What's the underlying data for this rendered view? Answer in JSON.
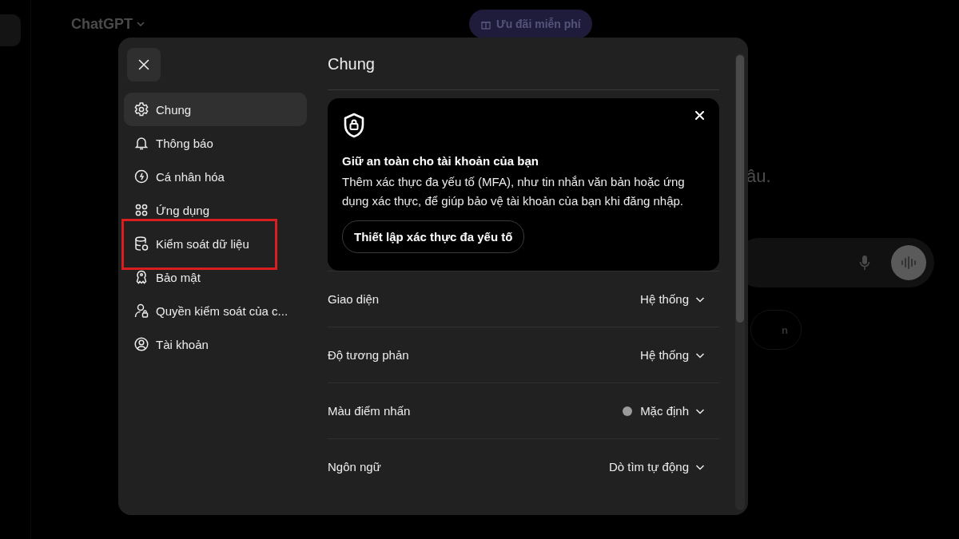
{
  "background": {
    "model_menu": "ChatGPT",
    "promo_button": "Ưu đãi miễn phí",
    "hero_fragment": "âu.",
    "chip_fragment": "n"
  },
  "settings_dialog": {
    "title": "Chung",
    "nav_items": [
      {
        "label": "Chung",
        "selected": true,
        "highlighted": false
      },
      {
        "label": "Thông báo",
        "selected": false,
        "highlighted": false
      },
      {
        "label": "Cá nhân hóa",
        "selected": false,
        "highlighted": false
      },
      {
        "label": "Ứng dụng",
        "selected": false,
        "highlighted": false
      },
      {
        "label": "Kiểm soát dữ liệu",
        "selected": false,
        "highlighted": true
      },
      {
        "label": "Bảo mật",
        "selected": false,
        "highlighted": false
      },
      {
        "label": "Quyền kiểm soát của c...",
        "selected": false,
        "highlighted": false
      },
      {
        "label": "Tài khoản",
        "selected": false,
        "highlighted": false
      }
    ],
    "security_card": {
      "heading": "Giữ an toàn cho tài khoản của bạn",
      "body": "Thêm xác thực đa yếu tố (MFA), như tin nhắn văn bản hoặc ứng dụng xác thực, để giúp bảo vệ tài khoản của bạn khi đăng nhập.",
      "button": "Thiết lập xác thực đa yếu tố"
    },
    "rows": [
      {
        "label": "Giao diện",
        "value": "Hệ thống"
      },
      {
        "label": "Độ tương phản",
        "value": "Hệ thống"
      },
      {
        "label": "Màu điểm nhấn",
        "value": "Mặc định",
        "color": "#9b9b9b"
      },
      {
        "label": "Ngôn ngữ",
        "value": "Dò tìm tự động"
      }
    ]
  }
}
